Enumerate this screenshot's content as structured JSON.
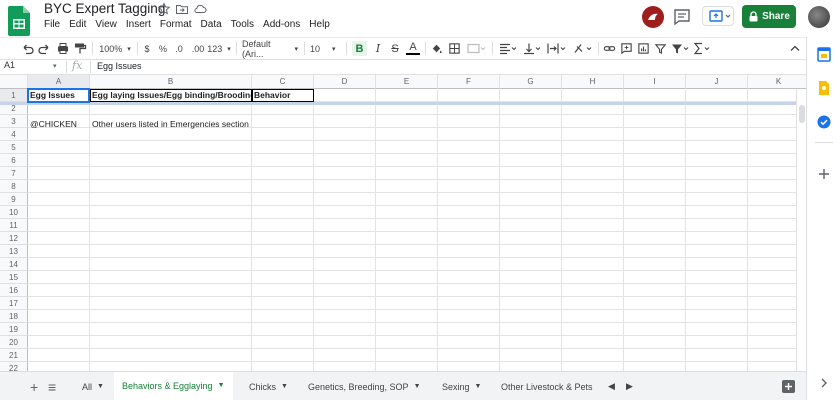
{
  "app": {
    "title": "BYC Expert Tagging",
    "menu": [
      "File",
      "Edit",
      "View",
      "Insert",
      "Format",
      "Data",
      "Tools",
      "Add-ons",
      "Help"
    ],
    "share_label": "Share",
    "brand_color": "#0f9d58",
    "share_color": "#188038"
  },
  "toolbar": {
    "zoom": "100%",
    "currency": "$",
    "percent": "%",
    "dec_less": ".0",
    "dec_more": ".00",
    "more_formats": "123",
    "font": "Default (Ari...",
    "font_size": "10",
    "bold": "B",
    "italic": "I",
    "strike": "S",
    "text_color": "A"
  },
  "formula_bar": {
    "cell_ref": "A1",
    "fx": "fx",
    "value": "Egg Issues"
  },
  "grid": {
    "columns": [
      "A",
      "B",
      "C",
      "D",
      "E",
      "F",
      "G",
      "H",
      "I",
      "J",
      "K"
    ],
    "rows": [
      "1",
      "2",
      "3",
      "4",
      "5",
      "6",
      "7",
      "8",
      "9",
      "10",
      "11",
      "12",
      "13",
      "14",
      "15",
      "16",
      "17",
      "18",
      "19",
      "20",
      "21",
      "22"
    ],
    "cells": {
      "A1": "Egg Issues",
      "B1": "Egg laying Issues/Egg binding/Broodiness",
      "C1": "Behavior",
      "A3": "@CHICKEN",
      "B3": "Other users listed in Emergencies section"
    }
  },
  "sheets": {
    "add": "+",
    "list": "≡",
    "tabs": [
      "All",
      "Behaviors & Egglaying",
      "Chicks",
      "Genetics, Breeding, SOP",
      "Sexing",
      "Other Livestock & Pets"
    ],
    "active": "Behaviors & Egglaying"
  }
}
